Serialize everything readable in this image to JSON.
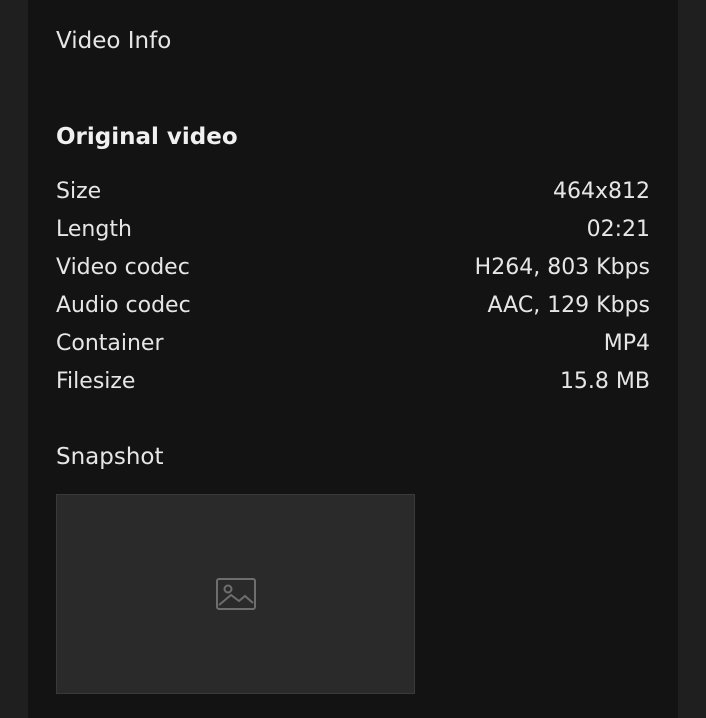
{
  "panel": {
    "title": "Video Info"
  },
  "original_video": {
    "heading": "Original video",
    "rows": [
      {
        "label": "Size",
        "value": "464x812"
      },
      {
        "label": "Length",
        "value": "02:21"
      },
      {
        "label": "Video codec",
        "value": "H264, 803 Kbps"
      },
      {
        "label": "Audio codec",
        "value": "AAC, 129 Kbps"
      },
      {
        "label": "Container",
        "value": "MP4"
      },
      {
        "label": "Filesize",
        "value": "15.8 MB"
      }
    ]
  },
  "snapshot": {
    "label": "Snapshot",
    "icon": "image-icon"
  },
  "colors": {
    "page_bg": "#1f1f1f",
    "panel_bg": "#131313",
    "text": "#e6e6e6"
  }
}
